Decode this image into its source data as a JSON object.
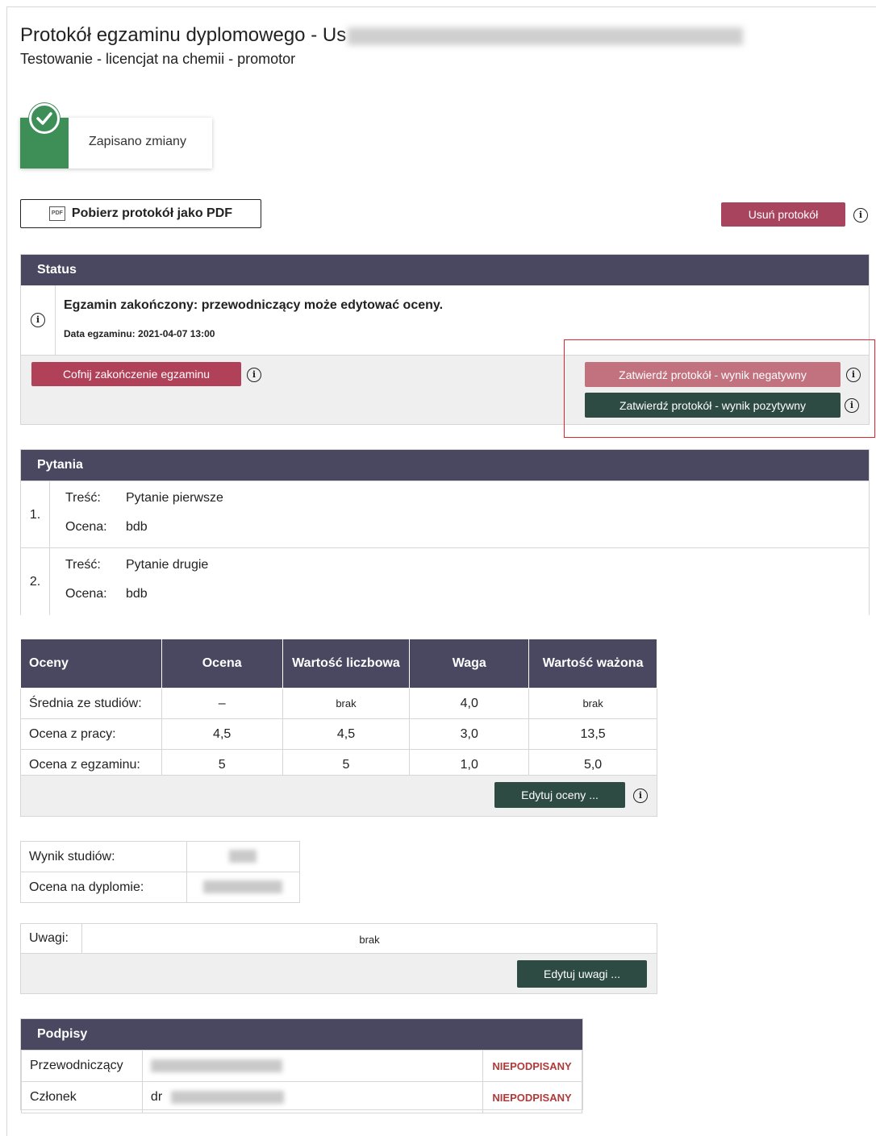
{
  "header": {
    "title": "Protokół egzaminu dyplomowego - Us",
    "subtitle": "Testowanie - licencjat na chemii - promotor"
  },
  "toast": {
    "message": "Zapisano zmiany"
  },
  "actions": {
    "download_pdf": "Pobierz protokół jako PDF",
    "pdf_icon": "PDF",
    "delete_protocol": "Usuń protokół"
  },
  "status": {
    "heading": "Status",
    "message": "Egzamin zakończony: przewodniczący może edytować oceny.",
    "exam_date": "Data egzaminu: 2021-04-07 13:00",
    "undo_button": "Cofnij zakończenie egzaminu",
    "approve_negative": "Zatwierdź protokół - wynik negatywny",
    "approve_positive": "Zatwierdź protokół - wynik pozytywny"
  },
  "questions": {
    "heading": "Pytania",
    "content_label": "Treść:",
    "grade_label": "Ocena:",
    "items": [
      {
        "num": "1.",
        "content": "Pytanie pierwsze",
        "grade": "bdb"
      },
      {
        "num": "2.",
        "content": "Pytanie drugie",
        "grade": "bdb"
      }
    ]
  },
  "grades": {
    "columns": [
      "Oceny",
      "Ocena",
      "Wartość liczbowa",
      "Waga",
      "Wartość ważona"
    ],
    "rows": [
      [
        "Średnia ze studiów:",
        "–",
        "brak",
        "4,0",
        "brak"
      ],
      [
        "Ocena z pracy:",
        "4,5",
        "4,5",
        "3,0",
        "13,5"
      ],
      [
        "Ocena z egzaminu:",
        "5",
        "5",
        "1,0",
        "5,0"
      ]
    ],
    "edit_button": "Edytuj oceny ..."
  },
  "result": {
    "study_result_label": "Wynik studiów:",
    "diploma_grade_label": "Ocena na dyplomie:"
  },
  "notes": {
    "label": "Uwagi:",
    "value": "brak",
    "edit_button": "Edytuj uwagi ..."
  },
  "signatures": {
    "heading": "Podpisy",
    "rows": [
      {
        "role": "Przewodniczący",
        "prefix": "",
        "status": "NIEPODPISANY"
      },
      {
        "role": "Członek",
        "prefix": "dr",
        "status": "NIEPODPISANY"
      }
    ]
  },
  "icons": {
    "info": "i",
    "colors": {
      "primary_dark": "#4a4860",
      "danger": "#b14059",
      "success_dark": "#2d4a43",
      "toast_green": "#3e8e57",
      "highlight": "#e2262c"
    }
  }
}
